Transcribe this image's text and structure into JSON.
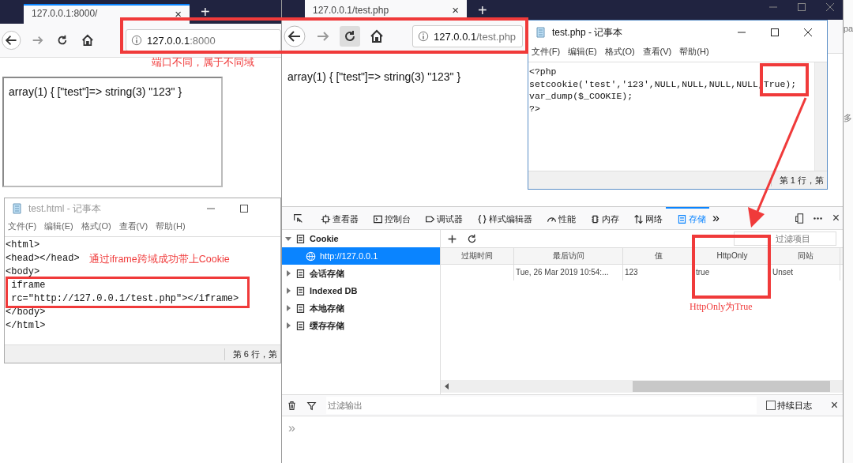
{
  "left_browser": {
    "tab": {
      "title": "127.0.0.1:8000/",
      "close": "×"
    },
    "new_tab": "+",
    "reload_pressed": false,
    "url": {
      "host": "127.0.0.1",
      "rest": ":8000"
    },
    "page_text": "array(1) { [\"test\"]=> string(3) \"123\" }"
  },
  "left_notepad": {
    "active": false,
    "title": "test.html - 记事本",
    "menu": [
      "文件(F)",
      "编辑(E)",
      "格式(O)",
      "查看(V)",
      "帮助(H)"
    ],
    "lines": [
      "<html>",
      "<head></head>",
      "<body>",
      " iframe",
      " rc=\"http://127.0.0.1/test.php\"></iframe>",
      "</body>",
      "</html>"
    ],
    "status": "第 6 行，第"
  },
  "right_browser": {
    "tab": {
      "title": "127.0.0.1/test.php",
      "close": "×"
    },
    "new_tab": "+",
    "reload_pressed": true,
    "url": {
      "host": "127.0.0.1",
      "rest": "/test.php"
    },
    "page_text": "array(1) { [\"test\"]=> string(3) \"123\" }",
    "devtools": {
      "tabs": [
        {
          "label": "查看器",
          "selected": false
        },
        {
          "label": "控制台",
          "selected": false
        },
        {
          "label": "调试器",
          "selected": false
        },
        {
          "label": "样式编辑器",
          "selected": false
        },
        {
          "label": "性能",
          "selected": false
        },
        {
          "label": "内存",
          "selected": false
        },
        {
          "label": "网络",
          "selected": false
        },
        {
          "label": "存储",
          "selected": true
        }
      ],
      "more": "»",
      "close": "×",
      "tree": [
        {
          "label": "Cookie",
          "expanded": true,
          "selected": false,
          "children": [
            {
              "label": "http://127.0.0.1",
              "selected": true
            }
          ]
        },
        {
          "label": "会话存储",
          "expanded": false,
          "selected": false
        },
        {
          "label": "Indexed DB",
          "expanded": false,
          "selected": false
        },
        {
          "label": "本地存储",
          "expanded": false,
          "selected": false
        },
        {
          "label": "缓存存储",
          "expanded": false,
          "selected": false
        }
      ],
      "filter": {
        "placeholder": "过滤项目"
      },
      "table": {
        "columns": [
          "过期时间",
          "最后访问",
          "值",
          "HttpOnly",
          "同站"
        ],
        "rows": [
          {
            "cells": [
              null,
              "Tue, 26 Mar 2019 10:54:...",
              "123",
              "true",
              "Unset"
            ]
          }
        ]
      },
      "console": {
        "filter_placeholder": "过滤输出",
        "persist": {
          "label": "持续日志",
          "checked": false
        },
        "close": "×",
        "prompt": "»"
      }
    }
  },
  "right_notepad": {
    "active": true,
    "title": "test.php - 记事本",
    "menu": [
      "文件(F)",
      "编辑(E)",
      "格式(O)",
      "查看(V)",
      "帮助(H)"
    ],
    "lines": [
      "<?php",
      "setcookie('test','123',NULL,NULL,NULL,NULL,True);",
      "var_dump($_COOKIE);",
      "?>"
    ],
    "status": "第 1 行，第"
  },
  "edge_fragments": [
    "pa",
    "多"
  ],
  "annotations": [
    {
      "text": "端口不同，属于不同域"
    },
    {
      "text": "通过iframe跨域成功带上Cookie"
    },
    {
      "text": "HttpOnly为True"
    }
  ]
}
